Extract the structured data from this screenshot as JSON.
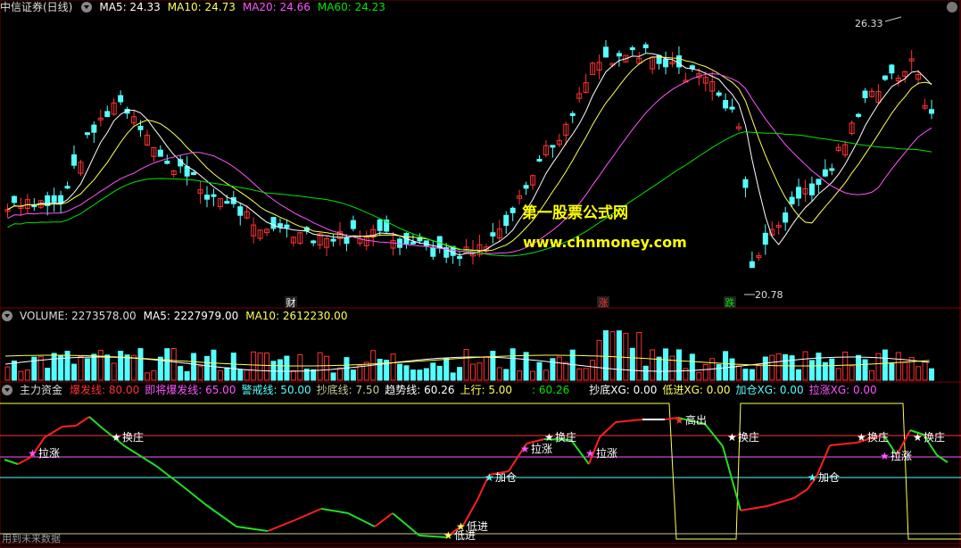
{
  "main": {
    "title": "中信证券(日线)",
    "ma5": "MA5: 24.33",
    "ma10": "MA10: 24.73",
    "ma20": "MA20: 24.66",
    "ma60": "MA60: 24.23",
    "high_label": "26.33",
    "low_label": "20.78",
    "watermark1": "第一股票公式网",
    "watermark2": "www.chnmoney.com",
    "events": [
      "财",
      "涨",
      "跌"
    ]
  },
  "volume": {
    "label": "VOLUME: 2273578.00",
    "ma5": "MA5: 2227979.00",
    "ma10": "MA10: 2612230.00"
  },
  "indicator": {
    "name": "主力资金",
    "burst": "爆发线: 80.00",
    "pre_burst": "即将爆发线: 65.00",
    "warn": "警戒线: 50.00",
    "bottom": "抄底线: 7.50",
    "trend": "趋势线: 60.26",
    "up": "上行: 5.00",
    "colon": ": 60.26",
    "xg1": "抄底XG: 0.00",
    "xg2": "低进XG: 0.00",
    "xg3": "加仓XG: 0.00",
    "xg4": "拉涨XG: 0.00",
    "signals": [
      "拉涨",
      "换庄",
      "加仓",
      "拉涨",
      "换庄",
      "拉涨",
      "高出",
      "换庄",
      "加仓",
      "换庄",
      "拉涨",
      "换庄",
      "低进",
      "低进"
    ],
    "footer": "用到未来数据"
  },
  "colors": {
    "up": "#ff3232",
    "down": "#54ffff",
    "ma5": "#ffffff",
    "ma10": "#ffff54",
    "ma20": "#ff54ff",
    "ma60": "#00e600"
  }
}
